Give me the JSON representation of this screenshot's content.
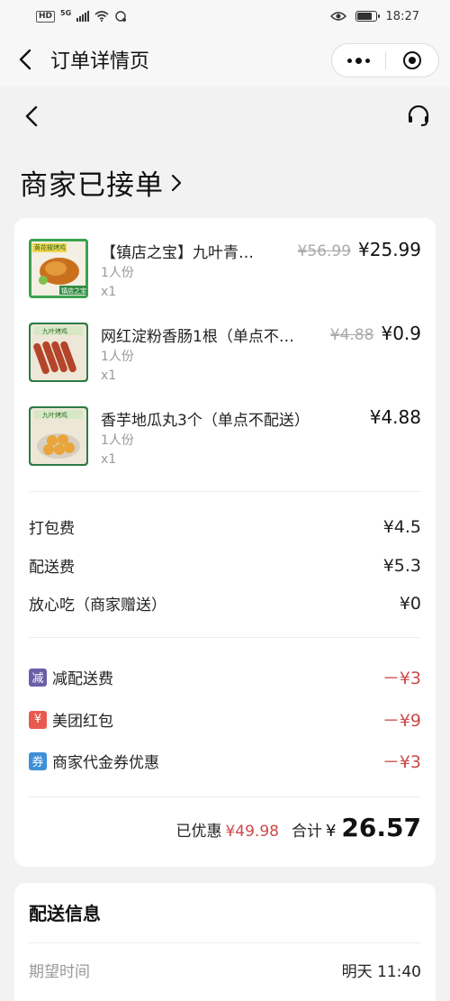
{
  "status_bar": {
    "time": "18:27",
    "network": "HD",
    "net_gen": "5G"
  },
  "titlebar": {
    "title": "订单详情页"
  },
  "order": {
    "status": "商家已接单",
    "items": [
      {
        "name": "【镇店之宝】九叶青…",
        "spec": "1人份",
        "qty": "x1",
        "original_price": "¥56.99",
        "price": "¥25.99",
        "thumb_label_top": "黄花椒烤鸡",
        "thumb_label_bottom": "镇店之宝"
      },
      {
        "name": "网红淀粉香肠1根（单点不…",
        "spec": "1人份",
        "qty": "x1",
        "original_price": "¥4.88",
        "price": "¥0.9",
        "thumb_label_top": "九叶烤鸡"
      },
      {
        "name": "香芋地瓜丸3个（单点不配送）",
        "spec": "1人份",
        "qty": "x1",
        "original_price": "",
        "price": "¥4.88",
        "thumb_label_top": "九叶烤鸡"
      }
    ],
    "fees": [
      {
        "label": "打包费",
        "value": "¥4.5"
      },
      {
        "label": "配送费",
        "value": "¥5.3"
      },
      {
        "label": "放心吃（商家赠送）",
        "value": "¥0"
      }
    ],
    "discounts": [
      {
        "badge": "减",
        "badge_color": "#6b5ea8",
        "label": "减配送费",
        "value": "－¥3"
      },
      {
        "badge": "¥",
        "badge_color": "#e85a4f",
        "label": "美团红包",
        "value": "－¥9"
      },
      {
        "badge": "券",
        "badge_color": "#3d8fd8",
        "label": "商家代金券优惠",
        "value": "－¥3"
      }
    ],
    "saved_label": "已优惠",
    "saved_value": "¥49.98",
    "total_label": "合计",
    "total_currency": "¥",
    "total_value": "26.57"
  },
  "delivery": {
    "title": "配送信息",
    "expected_time_label": "期望时间",
    "expected_time_value": "明天 11:40"
  },
  "colors": {
    "discount_red": "#cc4a4a",
    "page_bg": "#f2f2f2"
  }
}
